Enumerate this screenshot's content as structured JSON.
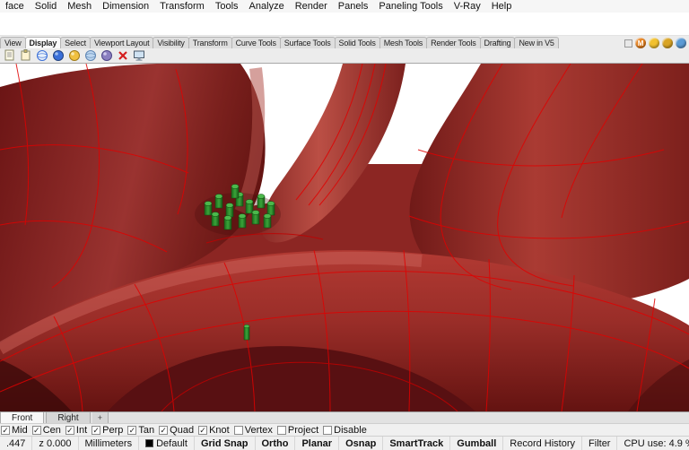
{
  "menu": {
    "items": [
      "face",
      "Solid",
      "Mesh",
      "Dimension",
      "Transform",
      "Tools",
      "Analyze",
      "Render",
      "Panels",
      "Paneling Tools",
      "V-Ray",
      "Help"
    ]
  },
  "ribbon": {
    "tabs": [
      "View",
      "Display",
      "Select",
      "Viewport Layout",
      "Visibility",
      "Transform",
      "Curve Tools",
      "Surface Tools",
      "Solid Tools",
      "Mesh Tools",
      "Render Tools",
      "Drafting",
      "New in V5"
    ],
    "active_tab": "Display"
  },
  "corner_icons": [
    {
      "name": "plugin-m-icon",
      "glyph": "M",
      "color": "#e8821e"
    },
    {
      "name": "plugin-yellow-ball-icon",
      "glyph": "",
      "color": "#f2c12e"
    },
    {
      "name": "plugin-gold-icon",
      "glyph": "",
      "color": "#d9a425"
    },
    {
      "name": "plugin-blue-icon",
      "glyph": "",
      "color": "#5b9bd5"
    }
  ],
  "viewport_tabs": {
    "front": "Front",
    "right": "Right",
    "new_tab_glyph": "+"
  },
  "osnap": {
    "items": [
      {
        "label": "Mid",
        "checked": true
      },
      {
        "label": "Cen",
        "checked": true
      },
      {
        "label": "Int",
        "checked": true
      },
      {
        "label": "Perp",
        "checked": true
      },
      {
        "label": "Tan",
        "checked": true
      },
      {
        "label": "Quad",
        "checked": true
      },
      {
        "label": "Knot",
        "checked": true
      },
      {
        "label": "Vertex",
        "checked": false
      },
      {
        "label": "Project",
        "checked": false
      },
      {
        "label": "Disable",
        "checked": false
      }
    ]
  },
  "statusbar": {
    "x_coord": ".447",
    "z_coord": "z 0.000",
    "units": "Millimeters",
    "layer": "Default",
    "panes": [
      "Grid Snap",
      "Ortho",
      "Planar",
      "Osnap",
      "SmartTrack",
      "Gumball"
    ],
    "record_history": "Record History",
    "filter": "Filter",
    "cpu": "CPU use: 4.9 %"
  },
  "scene": {
    "description": "Rendered close-up of interlocking dark red torus tubes with red isocurve wireframe and a cluster of small green cylinders at the center saddle",
    "colors": {
      "background": "#ffffff",
      "tube_highlight": "#c9625a",
      "tube_mid": "#a23530",
      "tube_dark": "#5c1111",
      "isocurve": "#e00000",
      "cylinder_green": "#2f9a2f"
    },
    "green_cylinders": [
      [
        228,
        156,
        8,
        13
      ],
      [
        240,
        148,
        8,
        13
      ],
      [
        252,
        158,
        8,
        13
      ],
      [
        263,
        146,
        8,
        13
      ],
      [
        274,
        154,
        8,
        13
      ],
      [
        287,
        148,
        8,
        13
      ],
      [
        298,
        156,
        8,
        13
      ],
      [
        236,
        168,
        8,
        13
      ],
      [
        250,
        172,
        8,
        13
      ],
      [
        266,
        170,
        8,
        13
      ],
      [
        281,
        166,
        8,
        13
      ],
      [
        294,
        170,
        8,
        13
      ],
      [
        258,
        137,
        8,
        13
      ],
      [
        272,
        293,
        6,
        15
      ]
    ]
  }
}
